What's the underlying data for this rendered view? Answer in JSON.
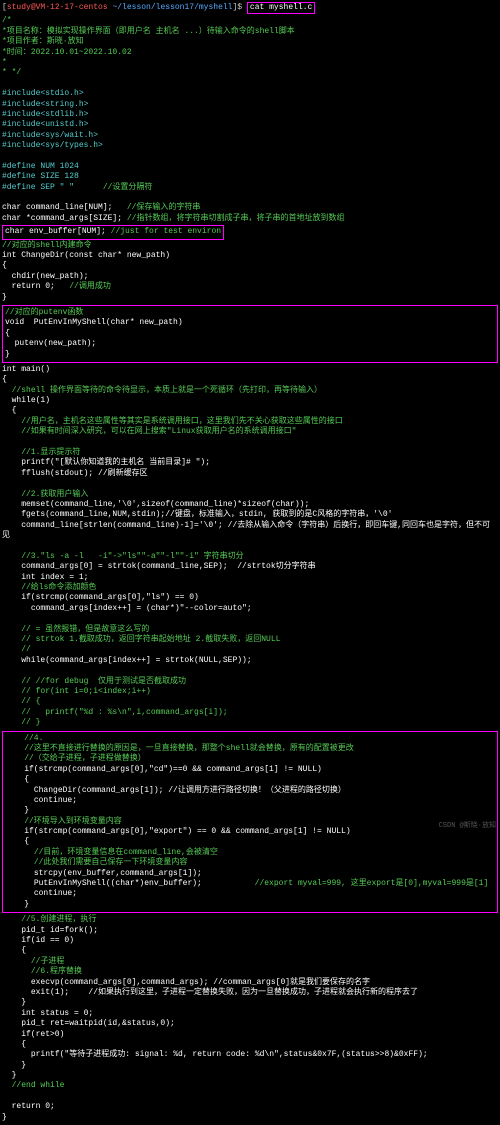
{
  "prompt": {
    "user": "study@VM-12-17-centos",
    "path": "~/lesson/lesson17/myshell",
    "dollar": "$",
    "command": "cat myshell.c"
  },
  "header": {
    "c1": "/*",
    "c2": "*项目名称：模拟实现操作界面（即用户名 主机名 ...）待输入命令的shell脚本",
    "c3": "*项目作者：斯晓·放知",
    "c4": "*时间：2022.10.01~2022.10.02",
    "c5": "*",
    "c6": "* */"
  },
  "includes": {
    "i1": "#include<stdio.h>",
    "i2": "#include<string.h>",
    "i3": "#include<stdlib.h>",
    "i4": "#include<unistd.h>",
    "i5": "#include<sys/wait.h>",
    "i6": "#include<sys/types.h>"
  },
  "defines": {
    "d1": "#define NUM 1024",
    "d2": "#define SIZE 128",
    "d3a": "#define SEP \" \"",
    "d3b": "//设置分隔符",
    "l1a": "char command_line[NUM];",
    "l1b": "//保存输入的字符串",
    "l2a": "char *command_args[SIZE];",
    "l2b": "//指针数组，将字符串切割成子串，将子串的首地址放到数组"
  },
  "envbox": {
    "a": "char env_buffer[NUM];",
    "b": "//just for test environ"
  },
  "func1": {
    "c1": "//对应的shell内建命令",
    "c2": "int ChangeDir(const char* new_path)",
    "c3": "{",
    "c4": "  chdir(new_path);",
    "c5a": "  return 0;",
    "c5b": "//调用成功",
    "c6": "}"
  },
  "func2": {
    "c1": "//对应的putenv函数",
    "c2": "void  PutEnvInMyShell(char* new_path)",
    "c3": "{",
    "c4": "  putenv(new_path);",
    "c5": "}"
  },
  "main": {
    "m1": "int main()",
    "m2": "{",
    "m3": "  //shell 操作界面等待的命令待显示，本质上就是一个死循环（先打印，再等待输入）",
    "m4": "  while(1)",
    "m5": "  {",
    "m6": "    //用户名，主机名这些属性等其实是系统调用接口，这里我们先不关心获取这些属性的接口",
    "m7": "    //如果有时间深入研究，可以在网上搜索\"Linux获取用户名的系统调用接口\"",
    "s1c": "    //1.显示提示符",
    "s1a": "    printf(\"[默认你知道我的主机名 当前目录]# \");",
    "s1b": "    fflush(stdout); //刷新缓存区",
    "s2c": "    //2.获取用户输入",
    "s2a": "    memset(command_line,'\\0',sizeof(command_line)*sizeof(char));",
    "s2b": "    fgets(command_line,NUM,stdin);//键盘，标准输入，stdin, 获取到的是C风格的字符串，'\\0'",
    "s2d": "    command_line[strlen(command_line)-1]='\\0'; //去除从输入命令（字符串）后换行，即回车键,同回车也是字符，但不可见",
    "s3c": "    //3.\"ls -a -l   -i\"->\"ls\"\"-a\"\"-l\"\"-i\" 字符串切分",
    "s3a": "    command_args[0] = strtok(command_line,SEP);  //strtok切分字符串",
    "s3b": "    int index = 1;",
    "s3d": "    //给ls命令添加颜色",
    "s3e": "    if(strcmp(command_args[0],\"ls\") == 0)",
    "s3f": "      command_args[index++] = (char*)\"--color=auto\";",
    "s3g": "    // = 虽然报错，但是故意这么写的",
    "s3h": "    // strtok 1.截取成功，返回字符串起始地址 2.截取失败，返回NULL",
    "s3i": "    //",
    "s3j": "    while(command_args[index++] = strtok(NULL,SEP));",
    "s3k": "    // //for debug  仅用于测试是否截取成功",
    "s3l": "    // for(int i=0;i<index;i++)",
    "s3m": "    // {",
    "s3n": "    //   printf(\"%d : %s\\n\",i,command_args[i]);",
    "s3o": "    // }"
  },
  "box4": {
    "c1": "    //4.",
    "c2": "    //这里不直接进行替换的原因是，一旦直接替换，那整个shell就会替换，原有的配置被更改",
    "c3": "    //（交给子进程，子进程做替换）",
    "c4": "    if(strcmp(command_args[0],\"cd\")==0 && command_args[1] != NULL)",
    "c5": "    {",
    "c6": "      ChangeDir(command_args[1]); //让调用方进行路径切换！（父进程的路径切换）",
    "c7": "      continue;",
    "c8": "    }",
    "c9": "    //环境导入到环境变量内容",
    "c10": "    if(strcmp(command_args[0],\"export\") == 0 && command_args[1] != NULL)",
    "c11": "    {",
    "c12": "      //目前，环境变量信息在command_line,会被清空",
    "c13": "      //此处我们需要自己保存一下环境变量内容",
    "c14": "      strcpy(env_buffer,command_args[1]);",
    "c15a": "      PutEnvInMyShell((char*)env_buffer);",
    "c15b": "//export myval=999, 这里export是[0],myval=999是[1]",
    "c16": "      continue;",
    "c17": "    }"
  },
  "tail": {
    "t1": "    //5.创建进程，执行",
    "t2": "    pid_t id=fork();",
    "t3": "    if(id == 0)",
    "t4": "    {",
    "t5": "      //子进程",
    "t6": "      //6.程序替换",
    "t7": "      execvp(command_args[0],command_args); //comman_args[0]就是我们要保存的名字",
    "t8": "      exit(1);    //如果执行到这里，子进程一定替换失败，因为一旦替换成功，子进程就会执行新的程序去了",
    "t9": "    }",
    "t10": "    int status = 0;",
    "t11": "    pid_t ret=waitpid(id,&status,0);",
    "t12": "    if(ret>0)",
    "t13": "    {",
    "t14": "      printf(\"等待子进程成功: signal: %d, return code: %d\\n\",status&0x7F,(status>>8)&0xFF);",
    "t15": "    }",
    "t16": "  }",
    "t17": "  //end while",
    "t18": "",
    "t19": "  return 0;",
    "t20": "}"
  },
  "watermark": "CSDN @斯晓·放知"
}
